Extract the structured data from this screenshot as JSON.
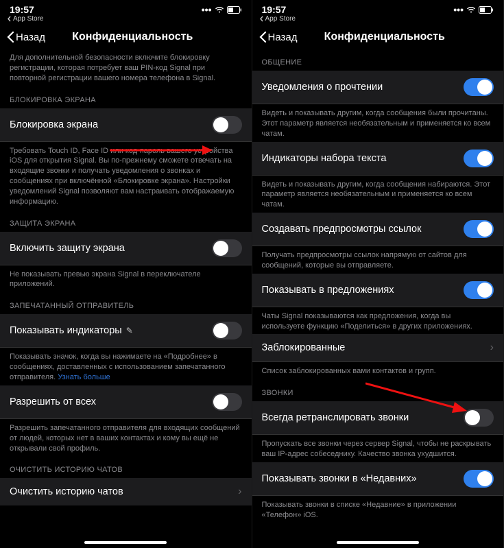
{
  "status": {
    "time": "19:57",
    "crumb": "App Store"
  },
  "nav": {
    "back": "Назад",
    "title": "Конфиденциальность"
  },
  "left": {
    "intro": "Для дополнительной безопасности включите блокировку регистрации, которая потребует ваш PIN-код Signal при повторной регистрации вашего номера телефона в Signal.",
    "sec_lock": "БЛОКИРОВКА ЭКРАНА",
    "row_lock": "Блокировка экрана",
    "desc_lock": "Требовать Touch ID, Face ID или код-пароль вашего устройства iOS для открытия Signal. Вы по-прежнему сможете отвечать на входящие звонки и получать уведомления о звонках и сообщениях при включённой «Блокировке экрана». Настройки уведомлений Signal позволяют вам настраивать отображаемую информацию.",
    "sec_protect": "ЗАЩИТА ЭКРАНА",
    "row_protect": "Включить защиту экрана",
    "desc_protect": "Не показывать превью экрана Signal в переключателе приложений.",
    "sec_sealed": "ЗАПЕЧАТАННЫЙ ОТПРАВИТЕЛЬ",
    "row_indicators": "Показывать индикаторы",
    "desc_indicators": "Показывать значок, когда вы нажимаете на «Подробнее» в сообщениях, доставленных с использованием запечатанного отправителя.",
    "learn_more": "Узнать больше",
    "row_allow_all": "Разрешить от всех",
    "desc_allow_all": "Разрешить запечатанного отправителя для входящих сообщений от людей, которых нет в ваших контактах и кому вы ещё не открывали свой профиль.",
    "sec_clear": "ОЧИСТИТЬ ИСТОРИЮ ЧАТОВ",
    "row_clear": "Очистить историю чатов"
  },
  "right": {
    "sec_chat": "ОБЩЕНИЕ",
    "row_read": "Уведомления о прочтении",
    "desc_read": "Видеть и показывать другим, когда сообщения были прочитаны. Этот параметр является необязательным и применяется ко всем чатам.",
    "row_typing": "Индикаторы набора текста",
    "desc_typing": "Видеть и показывать другим, когда сообщения набираются. Этот параметр является необязательным и применяется ко всем чатам.",
    "row_previews": "Создавать предпросмотры ссылок",
    "desc_previews": "Получать предпросмотры ссылок напрямую от сайтов для сообщений, которые вы отправляете.",
    "row_suggest": "Показывать в предложениях",
    "desc_suggest": "Чаты Signal показываются как предложения, когда вы используете функцию «Поделиться» в других приложениях.",
    "row_blocked": "Заблокированные",
    "desc_blocked": "Список заблокированных вами контактов и групп.",
    "sec_calls": "ЗВОНКИ",
    "row_relay": "Всегда ретранслировать звонки",
    "desc_relay": "Пропускать все звонки через сервер Signal, чтобы не раскрывать ваш IP-адрес собеседнику. Качество звонка ухудшится.",
    "row_recent": "Показывать звонки в «Недавних»",
    "desc_recent": "Показывать звонки в списке «Недавние» в приложении «Телефон» iOS."
  }
}
